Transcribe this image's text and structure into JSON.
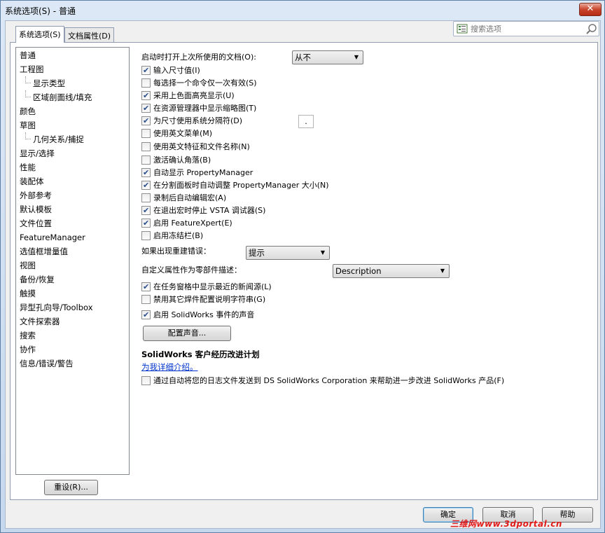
{
  "window": {
    "title": "系统选项(S) - 普通",
    "close_label": "✕"
  },
  "tabs": [
    {
      "label": "系统选项(S)",
      "active": true
    },
    {
      "label": "文档属性(D)",
      "active": false
    }
  ],
  "search": {
    "placeholder": "搜索选项"
  },
  "tree": [
    {
      "label": "普通",
      "level": 0
    },
    {
      "label": "工程图",
      "level": 0
    },
    {
      "label": "显示类型",
      "level": 1
    },
    {
      "label": "区域剖面线/填充",
      "level": 1
    },
    {
      "label": "颜色",
      "level": 0
    },
    {
      "label": "草图",
      "level": 0
    },
    {
      "label": "几何关系/捕捉",
      "level": 1
    },
    {
      "label": "显示/选择",
      "level": 0
    },
    {
      "label": "性能",
      "level": 0
    },
    {
      "label": "装配体",
      "level": 0
    },
    {
      "label": "外部参考",
      "level": 0
    },
    {
      "label": "默认模板",
      "level": 0
    },
    {
      "label": "文件位置",
      "level": 0
    },
    {
      "label": "FeatureManager",
      "level": 0
    },
    {
      "label": "选值框增量值",
      "level": 0
    },
    {
      "label": "视图",
      "level": 0
    },
    {
      "label": "备份/恢复",
      "level": 0
    },
    {
      "label": "触摸",
      "level": 0
    },
    {
      "label": "异型孔向导/Toolbox",
      "level": 0
    },
    {
      "label": "文件探索器",
      "level": 0
    },
    {
      "label": "搜索",
      "level": 0
    },
    {
      "label": "协作",
      "level": 0
    },
    {
      "label": "信息/错误/警告",
      "level": 0
    }
  ],
  "reset_label": "重设(R)...",
  "general": {
    "open_last_label": "启动时打开上次所使用的文档(O):",
    "open_last_value": "从不",
    "checkboxes": [
      {
        "label": "输入尺寸值(I)",
        "checked": true
      },
      {
        "label": "每选择一个命令仅一次有效(S)",
        "checked": false
      },
      {
        "label": "采用上色面高亮显示(U)",
        "checked": true
      },
      {
        "label": "在资源管理器中显示缩略图(T)",
        "checked": true
      },
      {
        "label": "为尺寸使用系统分隔符(D)",
        "checked": true
      },
      {
        "label": "使用英文菜单(M)",
        "checked": false
      },
      {
        "label": "使用英文特征和文件名称(N)",
        "checked": false
      },
      {
        "label": "激活确认角落(B)",
        "checked": false
      },
      {
        "label": "自动显示 PropertyManager",
        "checked": true
      },
      {
        "label": "在分割面板时自动调整 PropertyManager 大小(N)",
        "checked": true
      },
      {
        "label": "录制后自动编辑宏(A)",
        "checked": false
      },
      {
        "label": "在退出宏时停止 VSTA 调试器(S)",
        "checked": true
      },
      {
        "label": "启用 FeatureXpert(E)",
        "checked": true
      },
      {
        "label": "启用冻结栏(B)",
        "checked": false
      }
    ],
    "separator_value": ".",
    "rebuild_error_label": "如果出现重建错误：",
    "rebuild_error_value": "提示",
    "custom_prop_label": "自定义属性作为零部件描述：",
    "custom_prop_value": "Description",
    "checkboxes2": [
      {
        "label": "在任务窗格中显示最近的新闻源(L)",
        "checked": true
      },
      {
        "label": "禁用其它焊件配置说明字符串(G)",
        "checked": false
      }
    ],
    "sound_checkbox": {
      "label": "启用 SolidWorks 事件的声音",
      "checked": true
    },
    "config_sound_label": "配置声音...",
    "program_title": "SolidWorks 客户经历改进计划",
    "learn_more_link": "为我详细介绍。",
    "program_checkbox": {
      "label": "通过自动将您的日志文件发送到 DS SolidWorks Corporation 来帮助进一步改进 SolidWorks 产品(F)",
      "checked": false
    }
  },
  "footer": {
    "ok_label": "确定",
    "cancel_label": "取消",
    "help_label": "帮助"
  },
  "watermark": "三维网www.3dportal.cn"
}
